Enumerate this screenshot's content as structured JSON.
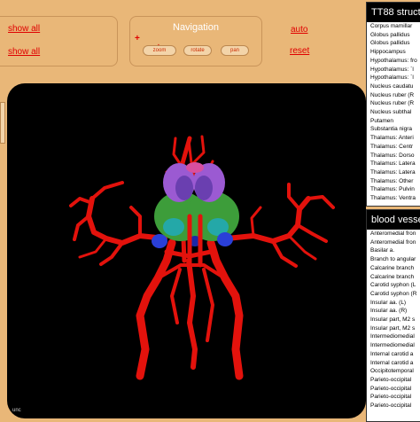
{
  "left_panel": {
    "show_all_1": "show all",
    "show_all_2": "show all"
  },
  "navigation": {
    "title": "Navigation",
    "zoom": "zoom",
    "rotate": "rotate",
    "pan": "pan"
  },
  "right_controls": {
    "auto": "auto",
    "reset": "reset"
  },
  "structures": {
    "title": "TT88  structu",
    "items": [
      "Corpus mamillar",
      "Globus pallidus",
      "Globus pallidus",
      "Hippocampus",
      "Hypothalamus: fro",
      "Hypothalamus: `l",
      "Hypothalamus: `l",
      "Nucleus caudatu",
      "Nucleus ruber (R",
      "Nucleus ruber (R",
      "Nucleus subthal",
      "Putamen",
      "Substantia nigra",
      "Thalamus: Anteri",
      "Thalamus: Centr",
      "Thalamus: Dorso",
      "Thalamus: Latera",
      "Thalamus: Latera",
      "Thalamus: Other",
      "Thalamus: Pulvin",
      "Thalamus: Ventra"
    ]
  },
  "vessels": {
    "title": "blood vesse",
    "items": [
      "Anteromedial fron",
      "Anteromedial fron",
      "Basilar a.",
      "Branch to angular",
      "Calcarine branch",
      "Calcarine branch",
      "Carotid syphon (L",
      "Carotid syphon (R",
      "Insular aa. (L)",
      "Insular aa. (R)",
      "Insular part, M2 s",
      "Insular part, M2 s",
      "Intermediomedial",
      "Intermediomedial",
      "Internal carotid a",
      "Internal carotid a",
      "Occipitotemporal",
      "Parieto-occipital",
      "Parieto-occipital",
      "Parieto-occipital",
      "Parieto-occipital"
    ]
  },
  "viewer_corner": "unc"
}
